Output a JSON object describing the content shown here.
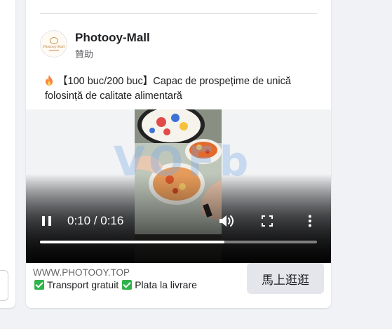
{
  "ad": {
    "page_name": "Photooy-Mall",
    "sponsored_label": "贊助",
    "avatar_logo_text": "Photooy Mall",
    "post_text": "【100 buc/200 buc】Capac de prospețime de unică folosință de calitate alimentară",
    "fire_icon": "fire-icon",
    "video": {
      "watermark": "VOFb",
      "time_display": "0:10 / 0:16",
      "progress": 0.667,
      "controls": [
        "pause-icon",
        "volume-icon",
        "fullscreen-icon",
        "more-icon"
      ]
    },
    "footer": {
      "domain": "WWW.PHOTOOY.TOP",
      "features": [
        "Transport gratuit",
        "Plata la livrare"
      ],
      "cta_label": "馬上逛逛"
    }
  },
  "colors": {
    "background": "#f0f2f5",
    "card": "#ffffff",
    "check_green": "#2fb34a",
    "cta_bg": "#e4e6eb"
  }
}
